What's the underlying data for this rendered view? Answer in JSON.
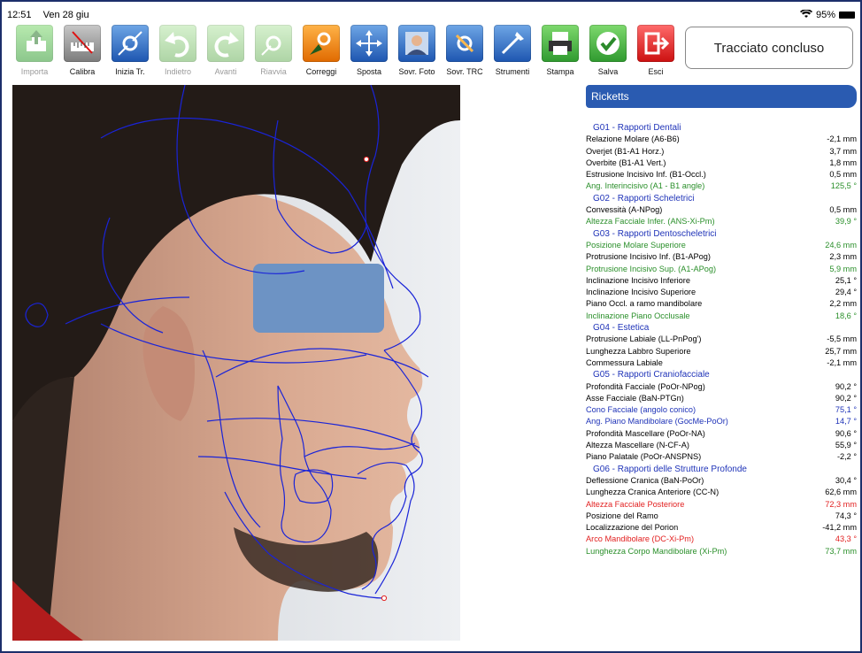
{
  "status_bar": {
    "time": "12:51",
    "date": "Ven 28 giu",
    "battery": "95%"
  },
  "toolbar": [
    {
      "label": "Importa",
      "icon": "import-icon",
      "color": "green",
      "disabled": true
    },
    {
      "label": "Calibra",
      "icon": "calibrate-icon",
      "color": "gray",
      "disabled": false
    },
    {
      "label": "Inizia Tr.",
      "icon": "start-trace-icon",
      "color": "blue",
      "disabled": false
    },
    {
      "label": "Indietro",
      "icon": "undo-icon",
      "color": "lgreen",
      "disabled": true
    },
    {
      "label": "Avanti",
      "icon": "redo-icon",
      "color": "lgreen",
      "disabled": true
    },
    {
      "label": "Riavvia",
      "icon": "restart-icon",
      "color": "lgreen",
      "disabled": true
    },
    {
      "label": "Correggi",
      "icon": "correct-icon",
      "color": "orange",
      "disabled": false
    },
    {
      "label": "Sposta",
      "icon": "move-icon",
      "color": "blue",
      "disabled": false
    },
    {
      "label": "Sovr. Foto",
      "icon": "overlay-photo-icon",
      "color": "blue",
      "disabled": false
    },
    {
      "label": "Sovr. TRC",
      "icon": "overlay-trc-icon",
      "color": "blue",
      "disabled": false
    },
    {
      "label": "Strumenti",
      "icon": "tools-icon",
      "color": "blue",
      "disabled": false
    },
    {
      "label": "Stampa",
      "icon": "print-icon",
      "color": "green",
      "disabled": false
    },
    {
      "label": "Salva",
      "icon": "save-icon",
      "color": "green",
      "disabled": false
    },
    {
      "label": "Esci",
      "icon": "exit-icon",
      "color": "red",
      "disabled": false
    }
  ],
  "trace_status": "Tracciato concluso",
  "panel": {
    "title": "Ricketts",
    "rows": [
      {
        "type": "group",
        "label": "G01 - Rapporti Dentali"
      },
      {
        "label": "Relazione Molare (A6-B6)",
        "value": "-2,1 mm"
      },
      {
        "label": "Overjet (B1-A1 Horz.)",
        "value": "3,7 mm"
      },
      {
        "label": "Overbite (B1-A1 Vert.)",
        "value": "1,8 mm"
      },
      {
        "label": "Estrusione Incisivo Inf. (B1-Occl.)",
        "value": "0,5 mm"
      },
      {
        "label": "Ang. Interincisivo (A1 - B1 angle)",
        "value": "125,5 °",
        "color": "green"
      },
      {
        "type": "group",
        "label": "G02 - Rapporti Scheletrici"
      },
      {
        "label": "Convessità (A-NPog)",
        "value": "0,5 mm"
      },
      {
        "label": "Altezza Facciale Infer. (ANS-Xi-Pm)",
        "value": "39,9 °",
        "color": "green"
      },
      {
        "type": "group",
        "label": "G03 - Rapporti Dentoscheletrici"
      },
      {
        "label": "Posizione Molare Superiore",
        "value": "24,6 mm",
        "color": "green"
      },
      {
        "label": "Protrusione Incisivo Inf. (B1-APog)",
        "value": "2,3 mm"
      },
      {
        "label": "Protrusione Incisivo Sup. (A1-APog)",
        "value": "5,9 mm",
        "color": "green"
      },
      {
        "label": "Inclinazione Incisivo Inferiore",
        "value": "25,1 °"
      },
      {
        "label": "Inclinazione Incisivo Superiore",
        "value": "29,4 °"
      },
      {
        "label": "Piano Occl. a ramo mandibolare",
        "value": "2,2 mm"
      },
      {
        "label": "Inclinazione Piano Occlusale",
        "value": "18,6 °",
        "color": "green"
      },
      {
        "type": "group",
        "label": "G04 - Estetica"
      },
      {
        "label": "Protrusione Labiale (LL-PnPog')",
        "value": "-5,5 mm"
      },
      {
        "label": "Lunghezza Labbro Superiore",
        "value": "25,7 mm"
      },
      {
        "label": "Commessura Labiale",
        "value": "-2,1 mm"
      },
      {
        "type": "group",
        "label": "G05 - Rapporti Craniofacciale"
      },
      {
        "label": "Profondità Facciale (PoOr-NPog)",
        "value": "90,2 °"
      },
      {
        "label": "Asse Facciale (BaN-PTGn)",
        "value": "90,2 °"
      },
      {
        "label": "Cono Facciale (angolo conico)",
        "value": "75,1 °",
        "color": "blue"
      },
      {
        "label": "Ang. Piano Mandibolare (GocMe-PoOr)",
        "value": "14,7 °",
        "color": "blue"
      },
      {
        "label": "Profondità Mascellare (PoOr-NA)",
        "value": "90,6 °"
      },
      {
        "label": "Altezza Mascellare (N-CF-A)",
        "value": "55,9 °"
      },
      {
        "label": "Piano Palatale (PoOr-ANSPNS)",
        "value": "-2,2 °"
      },
      {
        "type": "group",
        "label": "G06 - Rapporti delle Strutture Profonde"
      },
      {
        "label": "Deflessione Cranica (BaN-PoOr)",
        "value": "30,4 °"
      },
      {
        "label": "Lunghezza Cranica Anteriore (CC-N)",
        "value": "62,6 mm"
      },
      {
        "label": "Altezza Facciale Posteriore",
        "value": "72,3 mm",
        "color": "red"
      },
      {
        "label": "Posizione del Ramo",
        "value": "74,3 °"
      },
      {
        "label": "Localizzazione del Porion",
        "value": "-41,2 mm"
      },
      {
        "label": "Arco Mandibolare (DC-Xi-Pm)",
        "value": "43,3 °",
        "color": "red"
      },
      {
        "label": "Lunghezza Corpo Mandibolare (Xi-Pm)",
        "value": "73,7 mm",
        "color": "green"
      }
    ]
  }
}
